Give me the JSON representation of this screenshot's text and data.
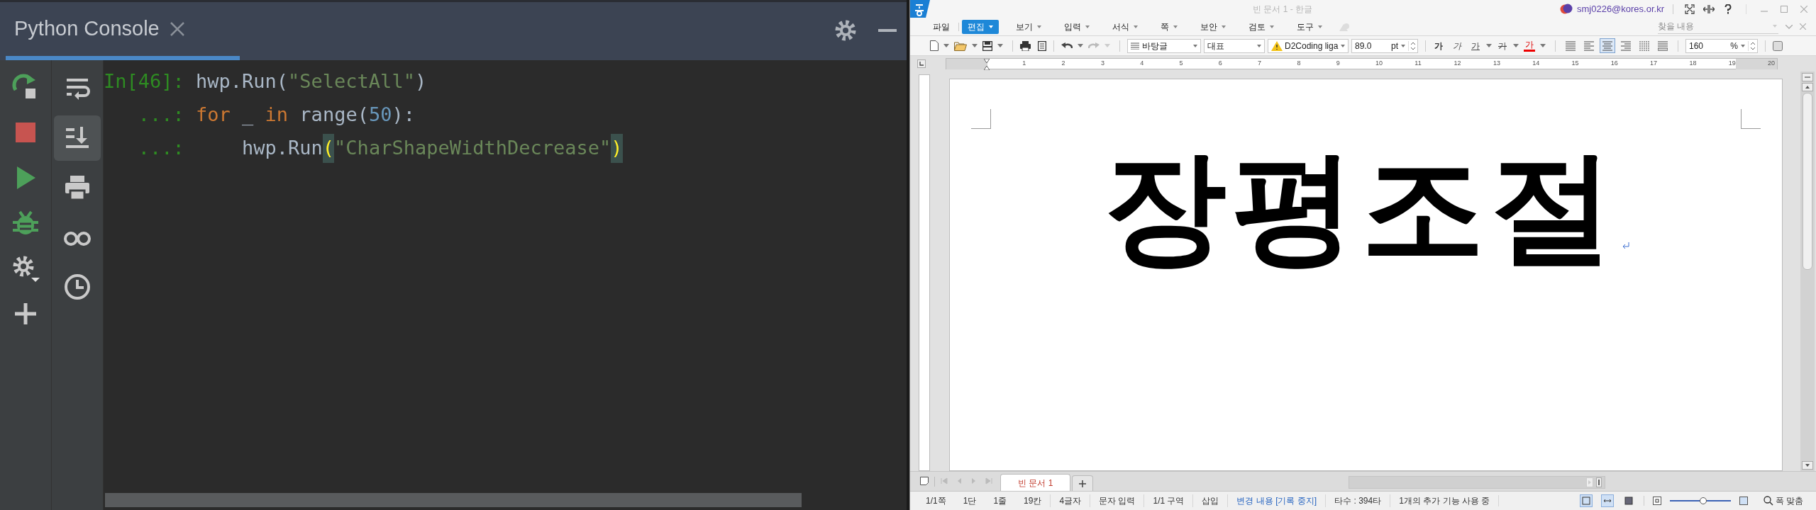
{
  "console": {
    "title": "Python Console",
    "toolbar": [
      {
        "kind": "rerun"
      },
      {
        "kind": "stop"
      },
      {
        "kind": "run"
      },
      {
        "kind": "debug"
      },
      {
        "kind": "settings"
      },
      {
        "kind": "add"
      }
    ],
    "toolbar_2": [
      {
        "kind": "soft-wrap",
        "on": false
      },
      {
        "kind": "scroll-end",
        "on": true
      },
      {
        "kind": "print",
        "on": false
      },
      {
        "kind": "glasses",
        "on": false
      },
      {
        "kind": "history",
        "on": false
      }
    ],
    "lines": [
      {
        "prompt": "In[46]:",
        "tokens": [
          {
            "text": "hwp.Run(",
            "kind": "plain"
          },
          {
            "text": "\"SelectAll\"",
            "kind": "string"
          },
          {
            "text": ")",
            "kind": "plain"
          }
        ]
      },
      {
        "prompt": "...:",
        "tokens": [
          {
            "text": "for",
            "kind": "keyword"
          },
          {
            "text": " _ ",
            "kind": "plain"
          },
          {
            "text": "in",
            "kind": "keyword"
          },
          {
            "text": " range(",
            "kind": "plain"
          },
          {
            "text": "50",
            "kind": "number"
          },
          {
            "text": "):",
            "kind": "plain"
          }
        ]
      },
      {
        "prompt": "...:",
        "tokens": [
          {
            "text": "    hwp.Run",
            "kind": "plain"
          },
          {
            "text": "(",
            "kind": "match"
          },
          {
            "text": "\"CharShapeWidthDecrease\"",
            "kind": "string"
          },
          {
            "text": ")",
            "kind": "match"
          }
        ]
      }
    ]
  },
  "hwp": {
    "title": "빈 문서 1 - 한글",
    "account": "smj0226@kores.or.kr",
    "menu": [
      {
        "label": "파일",
        "selected": false,
        "dropdown": false
      },
      {
        "label": "편집",
        "selected": true,
        "dropdown": true
      },
      {
        "label": "보기",
        "selected": false,
        "dropdown": true
      },
      {
        "label": "입력",
        "selected": false,
        "dropdown": true
      },
      {
        "label": "서식",
        "selected": false,
        "dropdown": true
      },
      {
        "label": "쪽",
        "selected": false,
        "dropdown": true
      },
      {
        "label": "보안",
        "selected": false,
        "dropdown": true
      },
      {
        "label": "검토",
        "selected": false,
        "dropdown": true
      },
      {
        "label": "도구",
        "selected": false,
        "dropdown": true
      }
    ],
    "search": {
      "placeholder": "찾을 내용"
    },
    "toolbar": {
      "style": "바탕글",
      "paragraph": "대표",
      "font": "D2Coding liga",
      "size": "89.0",
      "unit": "pt",
      "char_buttons": [
        {
          "label": "가",
          "kind": "bold"
        },
        {
          "label": "가",
          "kind": "italic"
        },
        {
          "label": "가",
          "kind": "underline"
        },
        {
          "label": "가",
          "kind": "strike"
        },
        {
          "label": "가",
          "kind": "color"
        }
      ],
      "align_buttons": [
        {
          "kind": "justify",
          "selected": false
        },
        {
          "kind": "left",
          "selected": false
        },
        {
          "kind": "center",
          "selected": true
        },
        {
          "kind": "right",
          "selected": false
        },
        {
          "kind": "distribute",
          "selected": false
        },
        {
          "kind": "divide",
          "selected": false
        }
      ],
      "line_spacing": "160",
      "line_spacing_unit": "%"
    },
    "ruler": [
      "1",
      "2",
      "3",
      "4",
      "5",
      "6",
      "7",
      "8",
      "9",
      "10",
      "11",
      "12",
      "13",
      "14",
      "15",
      "16",
      "17",
      "18",
      "19",
      "20"
    ],
    "document_text": "장평조절",
    "tabs": [
      {
        "label": "빈 문서 1",
        "selected": true
      }
    ],
    "status": [
      {
        "text": "1/1쪽",
        "kind": "text"
      },
      {
        "text": "1단",
        "kind": "text"
      },
      {
        "text": "1줄",
        "kind": "text"
      },
      {
        "text": "19칸",
        "kind": "text"
      },
      {
        "text": "4글자",
        "kind": "text"
      },
      {
        "text": "문자 입력",
        "kind": "text"
      },
      {
        "text": "1/1 구역",
        "kind": "text"
      },
      {
        "text": "삽입",
        "kind": "text"
      },
      {
        "text": "변경 내용 [기록 중지]",
        "kind": "tracking"
      },
      {
        "text": "타수 : 394타",
        "kind": "text"
      },
      {
        "text": "1개의 추가 기능 사용 중",
        "kind": "text"
      }
    ],
    "view_buttons": [
      {
        "kind": "page",
        "selected": true
      },
      {
        "kind": "width",
        "selected": true
      },
      {
        "kind": "full",
        "selected": false
      }
    ],
    "zoom": {
      "level": 0.55
    },
    "zoom_fit": "폭 맞춤"
  }
}
